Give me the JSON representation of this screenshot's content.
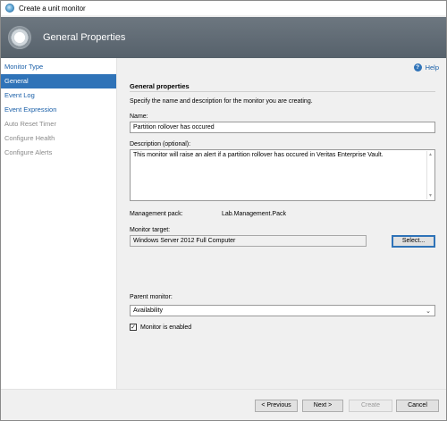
{
  "window": {
    "title": "Create a unit monitor"
  },
  "banner": {
    "title": "General Properties"
  },
  "sidebar": {
    "items": [
      {
        "label": "Monitor Type",
        "state": "link"
      },
      {
        "label": "General",
        "state": "active"
      },
      {
        "label": "Event Log",
        "state": "link"
      },
      {
        "label": "Event Expression",
        "state": "link"
      },
      {
        "label": "Auto Reset Timer",
        "state": "disabled"
      },
      {
        "label": "Configure Health",
        "state": "disabled"
      },
      {
        "label": "Configure Alerts",
        "state": "disabled"
      }
    ]
  },
  "help": {
    "label": "Help"
  },
  "general": {
    "section_title": "General properties",
    "description": "Specify the name and description for the monitor you are creating.",
    "name_label": "Name:",
    "name_value": "Partition rollover has occured",
    "desc_label": "Description (optional):",
    "desc_value": "This monitor will raise an alert if a partition rollover has occured in Veritas Enterprise Vault.",
    "mp_label": "Management pack:",
    "mp_value": "Lab.Management.Pack",
    "target_label": "Monitor target:",
    "target_value": "Windows Server 2012 Full Computer",
    "select_button": "Select...",
    "parent_label": "Parent monitor:",
    "parent_value": "Availability",
    "enabled_label": "Monitor is enabled",
    "enabled_checked": true
  },
  "footer": {
    "previous": "< Previous",
    "next": "Next >",
    "create": "Create",
    "cancel": "Cancel"
  }
}
